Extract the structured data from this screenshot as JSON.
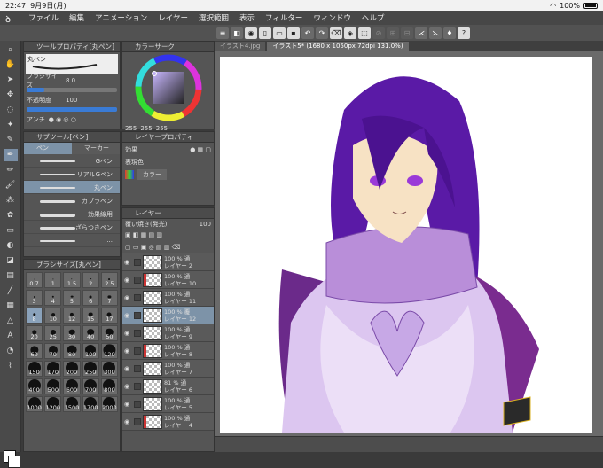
{
  "status": {
    "time": "22:47",
    "date": "9月9日(月)",
    "battery": "100%",
    "wifi_icon": "wifi-icon"
  },
  "menu": [
    "ファイル",
    "編集",
    "アニメーション",
    "レイヤー",
    "選択範囲",
    "表示",
    "フィルター",
    "ウィンドウ",
    "ヘルプ"
  ],
  "tool_property": {
    "title": "ツールプロパティ[丸ペン]",
    "tool_name": "丸ペン",
    "brush_size_label": "ブラシサイズ",
    "brush_size": "8.0",
    "opacity_label": "不透明度",
    "opacity": "100",
    "antialias_label": "アンチ"
  },
  "color_circle": {
    "title": "カラーサーク",
    "r": "255",
    "g": "255",
    "b": "255"
  },
  "subtool": {
    "title": "サブツール[ペン]",
    "tab_pen": "ペン",
    "tab_marker": "マーカー",
    "brushes": [
      "Gペン",
      "リアルGペン",
      "丸ペン",
      "カブラペン",
      "効果線用",
      "ざらつきペン",
      "..."
    ],
    "selected": 2
  },
  "brush_size_panel": {
    "title": "ブラシサイズ[丸ペン]",
    "sizes": [
      "0.7",
      "1",
      "1.5",
      "2",
      "2.5",
      "3",
      "4",
      "5",
      "6",
      "7",
      "8",
      "10",
      "12",
      "15",
      "17",
      "20",
      "25",
      "30",
      "40",
      "50",
      "60",
      "70",
      "80",
      "100",
      "120",
      "150",
      "170",
      "200",
      "250",
      "300",
      "400",
      "500",
      "600",
      "700",
      "800",
      "1000",
      "1200",
      "1500",
      "1700",
      "2000"
    ],
    "selected": 10
  },
  "layer_property": {
    "title": "レイヤープロパティ",
    "effect_label": "効果",
    "expression_label": "表現色",
    "color_mode": "カラー"
  },
  "layers_panel": {
    "title": "レイヤー",
    "blend": "覆い焼き(発光)",
    "opacity": "100",
    "layers": [
      {
        "pct": "100 % 通",
        "name": "レイヤー 2"
      },
      {
        "pct": "100 % 通",
        "name": "レイヤー 10"
      },
      {
        "pct": "100 % 通",
        "name": "レイヤー 11"
      },
      {
        "pct": "100 % 覆",
        "name": "レイヤー 12"
      },
      {
        "pct": "100 % 通",
        "name": "レイヤー 9"
      },
      {
        "pct": "100 % 通",
        "name": "レイヤー 8"
      },
      {
        "pct": "100 % 通",
        "name": "レイヤー 7"
      },
      {
        "pct": "81 % 通",
        "name": "レイヤー 6"
      },
      {
        "pct": "100 % 通",
        "name": "レイヤー 5"
      },
      {
        "pct": "100 % 通",
        "name": "レイヤー 4"
      }
    ],
    "selected": 3
  },
  "tabs": [
    "イラスト4.jpg",
    "イラスト5* (1680 x 1050px 72dpi 131.0%)"
  ],
  "colors": {
    "hair": "#5a1aa6",
    "accent": "#3a7bd5"
  }
}
